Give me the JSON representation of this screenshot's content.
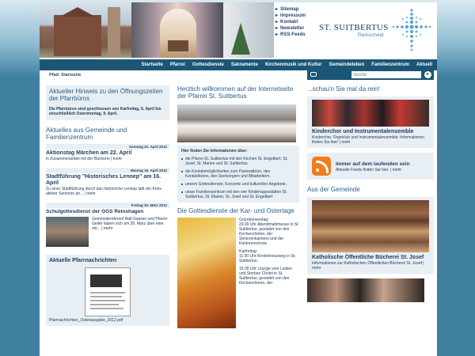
{
  "header": {
    "top_links": [
      "Sitemap",
      "Impressum",
      "Kontakt",
      "Newsletter",
      "RSS-Feeds"
    ],
    "brand": "ST. SUITBERTUS",
    "brand_sub": "Remscheid"
  },
  "nav": {
    "items": [
      "Startseite",
      "Pfarrei",
      "Gottesdienste",
      "Sakramente",
      "Kirchenmusik und Kultur",
      "Gemeindeleben",
      "Familienzentrum",
      "Aktuell"
    ]
  },
  "breadcrumb": "Pfad: Startseite",
  "search": {
    "label": "Suche",
    "value": ""
  },
  "left": {
    "notice_title": "Aktueller Hinweis zu den Öffnungszeiten der Pfarrbüros",
    "notice_text": "Die Pfarrbüros sind geschlossen von Karfreitag, 6. April bis einschließlich Ostermontag, 9. April.",
    "news_title": "Aktuelles aus Gemeinde und Familienzentrum",
    "news": [
      {
        "date": "Sonntag 22. April 2012",
        "title": "Aktionstag Märchen am 22. April",
        "text": "in Zusammenarbeit mit der Bücherei | mehr"
      },
      {
        "date": "Montag 16. April 2012",
        "title": "Stadtführung \"Historisches Lennep\" am 16. April",
        "text": "Zu einer Stadtführung durch das historische Lennep lädt der Kreis aktiver Senioren an... | mehr"
      },
      {
        "date": "Freitag 30. März 2012",
        "title": "Schulgottesdienst der GGS Reinshagen",
        "text": "Gemeindereferent Ralf Gassen und Pfarrer Geiler haben sich am 30. März über eine mit... | mehr"
      }
    ],
    "pfarr_title": "Aktuelle Pfarrnachrichten",
    "pfarr_link": "Pfarrnachrichten_Osterausgabe_2012.pdf"
  },
  "middle": {
    "welcome_title": "Herzlich willkommen auf der Internetseite der Pfarrei St. Suitbertus",
    "info_heading": "Hier finden Sie Informationen über:",
    "info_items": [
      "die Pfarrei St. Suitbertus mit den Kirchen St. Engelbert, St. Josef, St. Marien und St. Suitbertus",
      "die Kontaktmöglichkeiten zum Pastoralbüro, den Kontaktbüros, den Seelsorgern und Mitarbeitern.",
      "unsere Gottesdienste, Konzerte und kulturellen Angebote.",
      "unser Familienzentrum mit den vier Kindertagesstätten St. Suitbertus, St. Marien, St. Josef und St. Engelbert"
    ],
    "easter_title": "Die Gottesdienste der Kar- und Ostertage",
    "easter_text": [
      "Gründonnerstag:",
      "20.00 Uhr Abendmahlmesse in St. Suitbertus; gestaltet von den Kirchenchören, der Seniorenkantorei und der Kantorenschola",
      "Karfreitag:",
      "11.00 Uhr Kinderkreuzweg in St. Suitbertus;",
      "15.00 Uhr Liturgie vom Leiden und Sterben Christi in St. Suitbertus; gestaltet von den Kirchenchören, der"
    ]
  },
  "right": {
    "section1_title": "...schau'n Sie mal da rein!",
    "choir_title": "Kinderchor und Instrumentalensemble",
    "choir_text": "Kinderchor, Orgelclub und Instrumentalensemble: Informationen finden Sie hier! | mehr",
    "rss_title": "Immer auf dem laufenden sein",
    "rss_text": "Aktuelle Feeds finden Sie hier. | mehr",
    "community_title": "Aus der Gemeinde",
    "library_title": "Katholische Öffentliche Bücherei St. Josef",
    "library_text": "Informationen zur Katholischen Öffentlichen Bücherei St. Josef | mehr"
  }
}
